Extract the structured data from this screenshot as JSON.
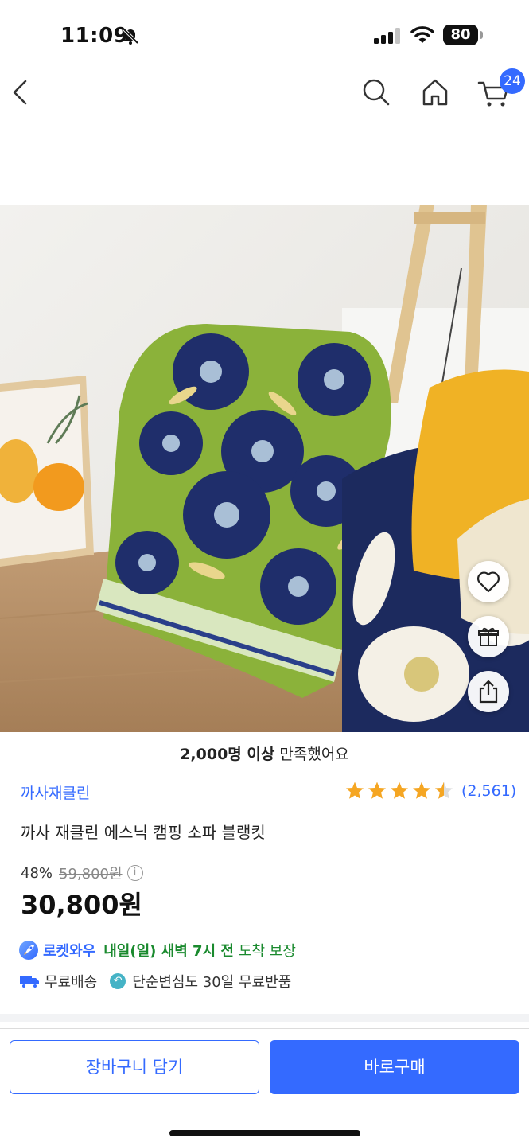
{
  "status_bar": {
    "time": "11:09",
    "battery": "80"
  },
  "nav": {
    "cart_count": "24"
  },
  "product": {
    "satisfaction_bold": "2,000명 이상",
    "satisfaction_rest": " 만족했어요",
    "brand": "까사재클린",
    "rating": 4.5,
    "review_count": "(2,561)",
    "title": "까사 재클린 에스닉 캠핑 소파 블랭킷",
    "discount": "48%",
    "original_price": "59,800원",
    "price": "30,800원"
  },
  "delivery": {
    "rocket_label": "로켓와우",
    "arrival_bold": "내일(일) 새벽 7시 전",
    "arrival_rest": "도착 보장",
    "free_shipping": "무료배송",
    "return_policy": "단순변심도 30일 무료반품"
  },
  "actions": {
    "add_to_cart": "장바구니 담기",
    "buy_now": "바로구매"
  },
  "colors": {
    "accent": "#346aff",
    "green": "#1a8a2e",
    "star": "#f5a623"
  }
}
